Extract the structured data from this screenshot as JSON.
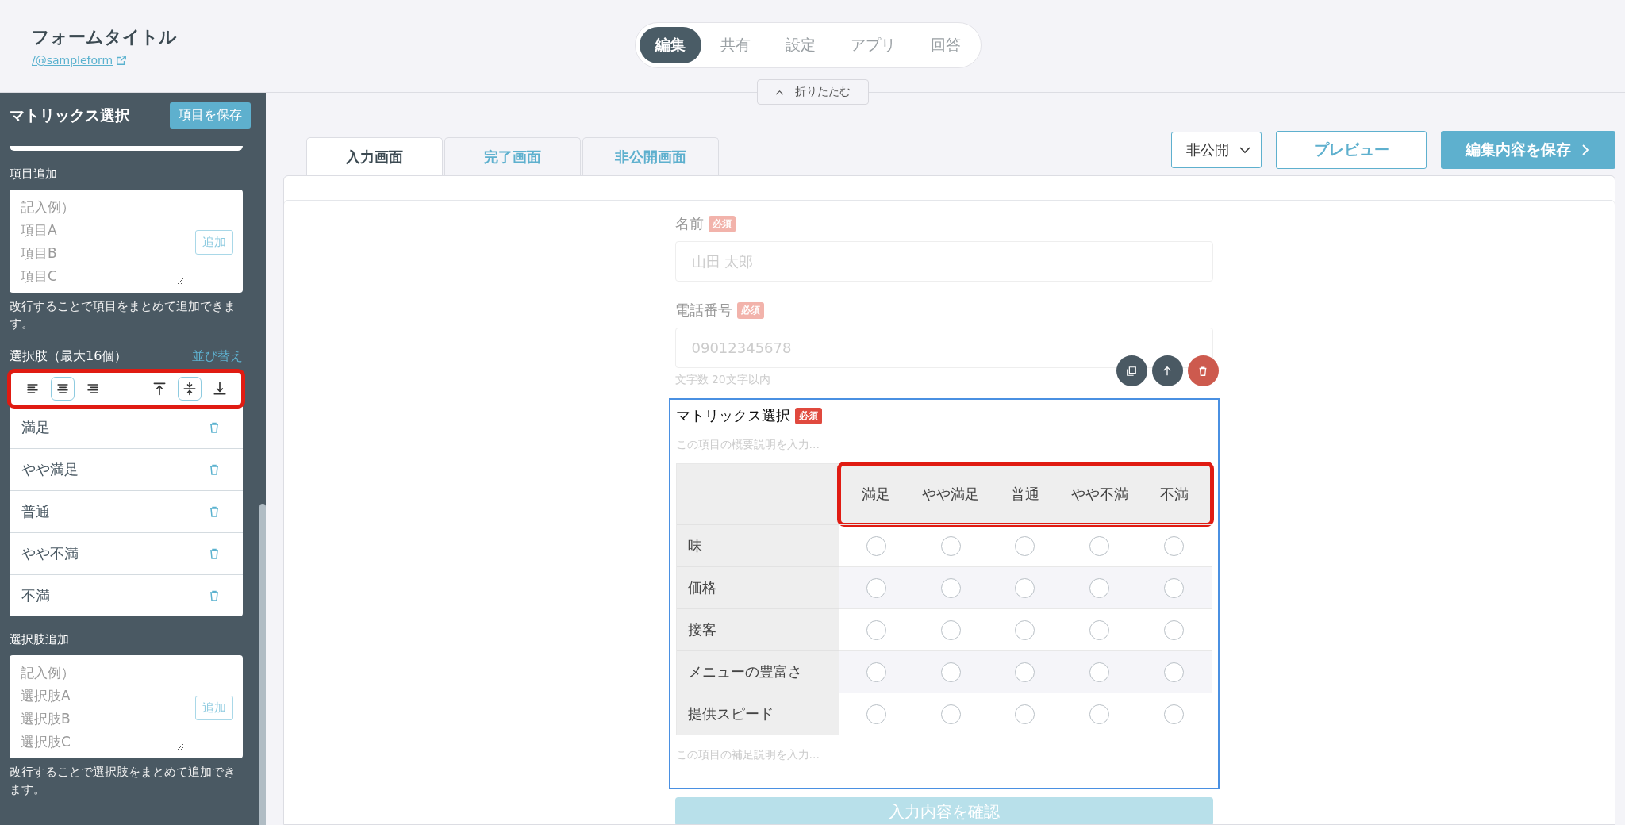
{
  "header": {
    "title": "フォームタイトル",
    "link": "/@sampleform"
  },
  "nav": {
    "tabs": [
      {
        "label": "編集",
        "selected": true
      },
      {
        "label": "共有",
        "selected": false
      },
      {
        "label": "設定",
        "selected": false
      },
      {
        "label": "アプリ",
        "selected": false
      },
      {
        "label": "回答",
        "selected": false
      }
    ],
    "collapse": "折りたたむ"
  },
  "sidebar": {
    "title": "マトリックス選択",
    "save_button": "項目を保存",
    "item_add": {
      "label": "項目追加",
      "placeholder": [
        "記入例）",
        "項目A",
        "項目B",
        "項目C"
      ],
      "button": "追加",
      "hint": "改行することで項目をまとめて追加できます。"
    },
    "choices": {
      "label": "選択肢（最大16個）",
      "sort_link": "並び替え",
      "toolbar_highlighted": true,
      "toolbar": [
        {
          "kind": "align-left",
          "selected": false
        },
        {
          "kind": "align-center",
          "selected": true
        },
        {
          "kind": "align-right",
          "selected": false
        },
        {
          "kind": "valign-top",
          "selected": false
        },
        {
          "kind": "valign-middle",
          "selected": true
        },
        {
          "kind": "valign-bottom",
          "selected": false
        }
      ],
      "items": [
        "満足",
        "やや満足",
        "普通",
        "やや不満",
        "不満"
      ]
    },
    "choice_add": {
      "label": "選択肢追加",
      "placeholder": [
        "記入例）",
        "選択肢A",
        "選択肢B",
        "選択肢C"
      ],
      "button": "追加",
      "hint": "改行することで選択肢をまとめて追加できます。"
    }
  },
  "screen_tabs": [
    {
      "label": "入力画面",
      "selected": true
    },
    {
      "label": "完了画面",
      "selected": false
    },
    {
      "label": "非公開画面",
      "selected": false
    }
  ],
  "actions": {
    "visibility": "非公開",
    "preview": "プレビュー",
    "save": "編集内容を保存"
  },
  "form": {
    "fields": [
      {
        "label": "名前",
        "required": "必須",
        "placeholder": "山田 太郎"
      },
      {
        "label": "電話番号",
        "required": "必須",
        "placeholder": "09012345678",
        "hint": "文字数 20文字以内"
      }
    ],
    "matrix": {
      "title": "マトリックス選択",
      "required": "必須",
      "description_placeholder": "この項目の概要説明を入力...",
      "header_highlighted": true,
      "columns": [
        "満足",
        "やや満足",
        "普通",
        "やや不満",
        "不満"
      ],
      "rows": [
        {
          "label": "味",
          "checked": [
            false,
            false,
            false,
            false,
            false
          ]
        },
        {
          "label": "価格",
          "checked": [
            false,
            false,
            false,
            false,
            false
          ]
        },
        {
          "label": "接客",
          "checked": [
            false,
            false,
            false,
            false,
            false
          ]
        },
        {
          "label": "メニューの豊富さ",
          "checked": [
            false,
            false,
            false,
            false,
            false
          ]
        },
        {
          "label": "提供スピード",
          "checked": [
            false,
            false,
            false,
            false,
            false
          ]
        }
      ],
      "note_placeholder": "この項目の補足説明を入力..."
    },
    "submit": "入力内容を確認"
  }
}
